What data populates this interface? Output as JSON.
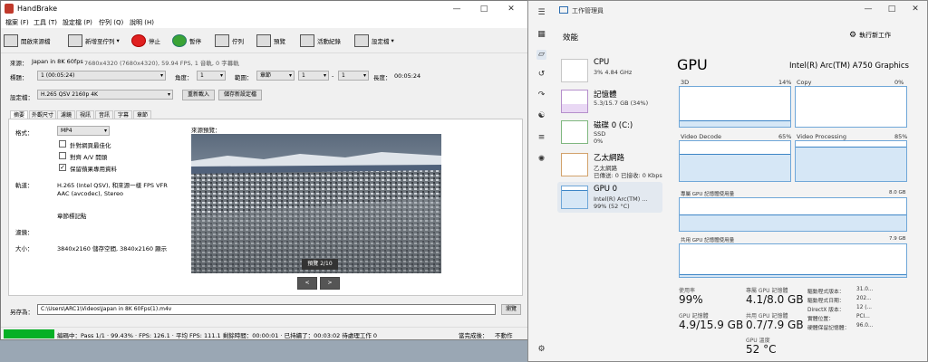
{
  "handbrake": {
    "title": "HandBrake",
    "menu": [
      "檔案 (F)",
      "工具 (T)",
      "設定檔 (P)",
      "佇列 (Q)",
      "說明 (H)"
    ],
    "toolbar": {
      "open_source": "開啟來源檔",
      "add_queue": "新增至佇列",
      "stop": "停止",
      "pause": "暫停",
      "queue": "佇列",
      "preview": "預覽",
      "activity_log": "活動紀錄",
      "presets": "設定檔"
    },
    "source": {
      "label": "來源：",
      "name": "Japan in 8K 60fps",
      "info": "7680x4320 (7680x4320), 59.94 FPS, 1 音軌, 0 字幕軌"
    },
    "title_row": {
      "title_label": "標題：",
      "title_value": "1 (00:05:24)",
      "angle_label": "角度：",
      "angle_value": "1",
      "range_label": "範圍：",
      "range_type": "章節",
      "range_from": "1",
      "range_sep": "-",
      "range_to": "1",
      "duration_label": "長度：",
      "duration_value": "00:05:24"
    },
    "preset": {
      "label": "設定檔：",
      "value": "H.265 QSV 2160p 4K",
      "reload": "重新載入",
      "save_new": "儲存新設定檔"
    },
    "tabs": [
      "摘要",
      "外觀尺寸",
      "濾鏡",
      "視訊",
      "音訊",
      "字幕",
      "章節"
    ],
    "summary": {
      "format_label": "格式：",
      "format_value": "MP4",
      "opt_web": "針對網頁最佳化",
      "opt_av": "對齊 A/V 開頭",
      "opt_ipod": "保留蘋果專用資料",
      "tracks_label": "軌道：",
      "track_video": "H.265 (Intel QSV), 和來源一樣 FPS VFR",
      "track_audio": "AAC (avcodec), Stereo",
      "track_chapters": "章節標記點",
      "filters_label": "濾鏡：",
      "size_label": "大小：",
      "size_value": "3840x2160 儲存空間, 3840x2160 顯示",
      "preview_title": "來源預覽：",
      "preview_counter": "預覽 2/10",
      "prev": "<",
      "next": ">"
    },
    "save_as": {
      "label": "另存為：",
      "path": "C:\\Users\\ARC1\\Videos\\Japan in 8K 60Fps(1).m4v",
      "browse": "瀏覽"
    },
    "status": {
      "progress": 0.1,
      "text": "編碼中：Pass 1/1 · 99.43% · FPS: 126.1 · 平均 FPS: 111.1 剩餘時間：00:00:01 · 已持續了：00:03:02   待處理工作 0",
      "when_done_label": "當完成後：",
      "when_done_value": "不動作"
    }
  },
  "taskmgr": {
    "title": "工作管理員",
    "section": "效能",
    "run_task": "執行新工作",
    "items": [
      {
        "name": "CPU",
        "line1": "3% 4.84 GHz",
        "line2": ""
      },
      {
        "name": "記憶體",
        "line1": "5.3/15.7 GB (34%)",
        "line2": ""
      },
      {
        "name": "磁碟 0 (C:)",
        "line1": "SSD",
        "line2": "0%"
      },
      {
        "name": "乙太網路",
        "line1": "乙太網路",
        "line2": "已傳送: 0 已接收: 0 Kbps"
      },
      {
        "name": "GPU 0",
        "line1": "Intel(R) Arc(TM) ...",
        "line2": "99% (52 °C)"
      }
    ],
    "gpu": {
      "heading": "GPU",
      "model": "Intel(R) Arc(TM) A750 Graphics",
      "engines": [
        {
          "name": "3D",
          "pct": "14%"
        },
        {
          "name": "Copy",
          "pct": "0%"
        },
        {
          "name": "Video Decode",
          "pct": "65%"
        },
        {
          "name": "Video Processing",
          "pct": "85%"
        }
      ],
      "dedicated_label": "專屬 GPU 記憶體使用量",
      "dedicated_max": "8.0 GB",
      "shared_label": "共用 GPU 記憶體使用量",
      "shared_max": "7.9 GB",
      "util_label": "使用率",
      "util_value": "99%",
      "ded_mem_label": "專屬 GPU 記憶體",
      "ded_mem_value": "4.1/8.0 GB",
      "gpu_mem_label": "GPU 記憶體",
      "gpu_mem_value": "4.9/15.9 GB",
      "shared_mem_label": "共用 GPU 記憶體",
      "shared_mem_value": "0.7/7.9 GB",
      "temp_label": "GPU 溫度",
      "temp_value": "52 °C",
      "driver_version_label": "驅動程式版本：",
      "driver_version": "31.0...",
      "driver_date_label": "驅動程式日期：",
      "driver_date": "202...",
      "directx_label": "DirectX 版本：",
      "directx": "12 (...",
      "location_label": "實體位置：",
      "location": "PCI...",
      "hw_reserved_label": "硬體保留記憶體：",
      "hw_reserved": "96.0..."
    }
  }
}
